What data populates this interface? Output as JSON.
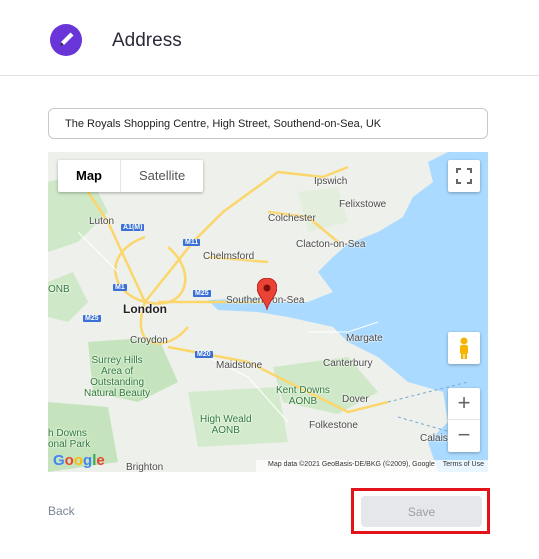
{
  "header": {
    "title": "Address",
    "icon": "pencil-icon",
    "icon_bg": "#6a35d8"
  },
  "address_field": {
    "value": "The Royals Shopping Centre, High Street, Southend-on-Sea, UK"
  },
  "map": {
    "type_buttons": [
      "Map",
      "Satellite"
    ],
    "selected_type": "Map",
    "places": {
      "ipswich": "Ipswich",
      "felixstowe": "Felixstowe",
      "colchester": "Colchester",
      "clacton": "Clacton-on-Sea",
      "chelmsford": "Chelmsford",
      "luton": "Luton",
      "london": "London",
      "southend": "Southend-on-Sea",
      "croydon": "Croydon",
      "margate": "Margate",
      "canterbury": "Canterbury",
      "maidstone": "Maidstone",
      "dover": "Dover",
      "folkestone": "Folkestone",
      "calais": "Calais",
      "brighton": "Brighton",
      "onb": "ONB"
    },
    "parks": {
      "surrey_hills": "Surrey Hills\nArea of\nOutstanding\nNatural Beauty",
      "kent_downs": "Kent Downs\nAONB",
      "high_weald": "High Weald\nAONB",
      "south_downs": "h Downs\nonal Park"
    },
    "roads": {
      "a1m": "A1(M)",
      "m11": "M11",
      "m1": "M1",
      "m25": "M25",
      "m25b": "M25",
      "m20": "M20",
      "m2": "M2"
    },
    "zoom_in": "+",
    "zoom_out": "−",
    "logo": "Google",
    "attribution": "Map data ©2021 GeoBasis-DE/BKG (©2009), Google",
    "terms": "Terms of Use",
    "colors": {
      "water": "#aadaff",
      "land": "#eef0eb",
      "park": "#c5e8c5",
      "road": "#fbd66b",
      "marker": "#ea4335"
    }
  },
  "footer": {
    "back_label": "Back",
    "save_label": "Save",
    "highlight_color": "#e3131b"
  }
}
